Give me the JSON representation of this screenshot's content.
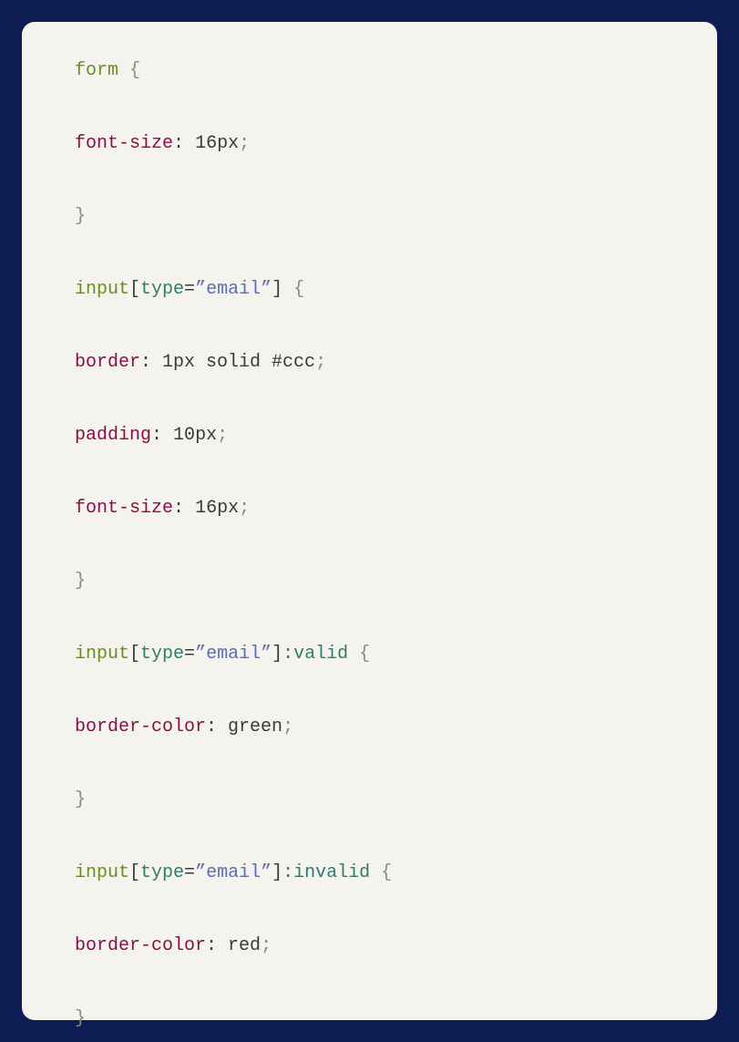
{
  "code": {
    "l1_form": "form",
    "l1_space": " ",
    "l1_open": "{",
    "l2_prop": "font-size",
    "l2_colon": ":",
    "l2_space": " ",
    "l2_num": "16",
    "l2_unit": "px",
    "l2_semi": ";",
    "l3_close": "}",
    "l4_input": "input",
    "l4_punct_brkopen": "[",
    "l4_type": "type",
    "l4_eq": "=",
    "l4_str": "”email”",
    "l4_brkclose": "]",
    "l4_space": " ",
    "l4_open": "{",
    "l5_prop": "border",
    "l5_colon": ":",
    "l5_val": " 1px solid #ccc",
    "l5_semi": ";",
    "l6_prop": "padding",
    "l6_colon": ":",
    "l6_space": " ",
    "l6_num": "10",
    "l6_unit": "px",
    "l6_semi": ";",
    "l7_prop": "font-size",
    "l7_colon": ":",
    "l7_space": " ",
    "l7_num": "16",
    "l7_unit": "px",
    "l7_semi": ";",
    "l8_close": "}",
    "l9_input": "input",
    "l9_brkopen": "[",
    "l9_type": "type",
    "l9_eq": "=",
    "l9_str": "”email”",
    "l9_brkclose": "]",
    "l9_pseudo": ":valid",
    "l9_space": " ",
    "l9_open": "{",
    "l10_prop": "border-color",
    "l10_colon": ":",
    "l10_val": " green",
    "l10_semi": ";",
    "l11_close": "}",
    "l12_input": "input",
    "l12_brkopen": "[",
    "l12_type": "type",
    "l12_eq": "=",
    "l12_str": "”email”",
    "l12_brkclose": "]",
    "l12_pseudo": ":invalid",
    "l12_space": " ",
    "l12_open": "{",
    "l13_prop": "border-color",
    "l13_colon": ":",
    "l13_val": " red",
    "l13_semi": ";",
    "l14_close": "}"
  }
}
